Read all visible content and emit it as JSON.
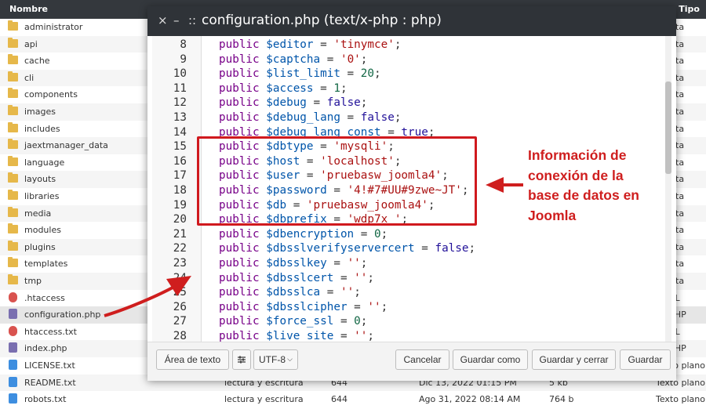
{
  "file_manager": {
    "columns": {
      "name": "Nombre",
      "type": "Tipo"
    },
    "rows": [
      {
        "name": "administrator",
        "kind": "folder",
        "type": "arpeta"
      },
      {
        "name": "api",
        "kind": "folder",
        "type": "arpeta"
      },
      {
        "name": "cache",
        "kind": "folder",
        "type": "arpeta"
      },
      {
        "name": "cli",
        "kind": "folder",
        "type": "arpeta"
      },
      {
        "name": "components",
        "kind": "folder",
        "type": "arpeta"
      },
      {
        "name": "images",
        "kind": "folder",
        "type": "arpeta"
      },
      {
        "name": "includes",
        "kind": "folder",
        "type": "arpeta"
      },
      {
        "name": "jaextmanager_data",
        "kind": "folder",
        "type": "arpeta"
      },
      {
        "name": "language",
        "kind": "folder",
        "type": "arpeta"
      },
      {
        "name": "layouts",
        "kind": "folder",
        "type": "arpeta"
      },
      {
        "name": "libraries",
        "kind": "folder",
        "type": "arpeta"
      },
      {
        "name": "media",
        "kind": "folder",
        "type": "arpeta"
      },
      {
        "name": "modules",
        "kind": "folder",
        "type": "arpeta"
      },
      {
        "name": "plugins",
        "kind": "folder",
        "type": "arpeta"
      },
      {
        "name": "templates",
        "kind": "folder",
        "type": "arpeta"
      },
      {
        "name": "tmp",
        "kind": "folder",
        "type": "arpeta"
      },
      {
        "name": ".htaccess",
        "kind": "htaccess",
        "type": "HTML"
      },
      {
        "name": "configuration.php",
        "kind": "php",
        "type": "go PHP"
      },
      {
        "name": "htaccess.txt",
        "kind": "htaccess",
        "type": "HTML"
      },
      {
        "name": "index.php",
        "kind": "php",
        "type": "go PHP"
      },
      {
        "name": "LICENSE.txt",
        "kind": "txt",
        "type": "Texto plano"
      },
      {
        "name": "README.txt",
        "kind": "txt",
        "type": "Texto plano",
        "permissions": "lectura y escritura",
        "octal": "644",
        "date": "Dic 13, 2022 01:15 PM",
        "size": "5 kb"
      },
      {
        "name": "robots.txt",
        "kind": "txt",
        "type": "Texto plano",
        "permissions": "lectura y escritura",
        "octal": "644",
        "date": "Ago 31, 2022 08:14 AM",
        "size": "764 b"
      }
    ]
  },
  "dialog": {
    "close_icon": "×",
    "minimize_icon": "–",
    "drag_icon": "::",
    "title": "configuration.php (text/x-php : php)",
    "code_lines": [
      {
        "n": "8",
        "var": "$editor",
        "value": "'tinymce'",
        "vtype": "str"
      },
      {
        "n": "9",
        "var": "$captcha",
        "value": "'0'",
        "vtype": "str"
      },
      {
        "n": "10",
        "var": "$list_limit",
        "value": "20",
        "vtype": "num"
      },
      {
        "n": "11",
        "var": "$access",
        "value": "1",
        "vtype": "num"
      },
      {
        "n": "12",
        "var": "$debug",
        "value": "false",
        "vtype": "atom"
      },
      {
        "n": "13",
        "var": "$debug_lang",
        "value": "false",
        "vtype": "atom"
      },
      {
        "n": "14",
        "var": "$debug_lang_const",
        "value": "true",
        "vtype": "atom"
      },
      {
        "n": "15",
        "var": "$dbtype",
        "value": "'mysqli'",
        "vtype": "str"
      },
      {
        "n": "16",
        "var": "$host",
        "value": "'localhost'",
        "vtype": "str"
      },
      {
        "n": "17",
        "var": "$user",
        "value": "'pruebasw_joomla4'",
        "vtype": "str"
      },
      {
        "n": "18",
        "var": "$password",
        "value": "'4!#7#UU#9zwe~JT'",
        "vtype": "str"
      },
      {
        "n": "19",
        "var": "$db",
        "value": "'pruebasw_joomla4'",
        "vtype": "str"
      },
      {
        "n": "20",
        "var": "$dbprefix",
        "value": "'wdp7x_'",
        "vtype": "str"
      },
      {
        "n": "21",
        "var": "$dbencryption",
        "value": "0",
        "vtype": "num"
      },
      {
        "n": "22",
        "var": "$dbsslverifyservercert",
        "value": "false",
        "vtype": "atom"
      },
      {
        "n": "23",
        "var": "$dbsslkey",
        "value": "''",
        "vtype": "str"
      },
      {
        "n": "24",
        "var": "$dbsslcert",
        "value": "''",
        "vtype": "str"
      },
      {
        "n": "25",
        "var": "$dbsslca",
        "value": "''",
        "vtype": "str"
      },
      {
        "n": "26",
        "var": "$dbsslcipher",
        "value": "''",
        "vtype": "str"
      },
      {
        "n": "27",
        "var": "$force_ssl",
        "value": "0",
        "vtype": "num"
      },
      {
        "n": "28",
        "var": "$live_site",
        "value": "''",
        "vtype": "str"
      }
    ],
    "keyword": "public",
    "footer": {
      "textarea_button": "Área de texto",
      "settings_icon": "sliders-icon",
      "encoding": "UTF-8",
      "cancel": "Cancelar",
      "save_as": "Guardar como",
      "save_close": "Guardar y cerrar",
      "save": "Guardar"
    }
  },
  "annotation": {
    "text": "Información de conexión de la base de datos en Joomla",
    "color": "#cf1e1e"
  }
}
